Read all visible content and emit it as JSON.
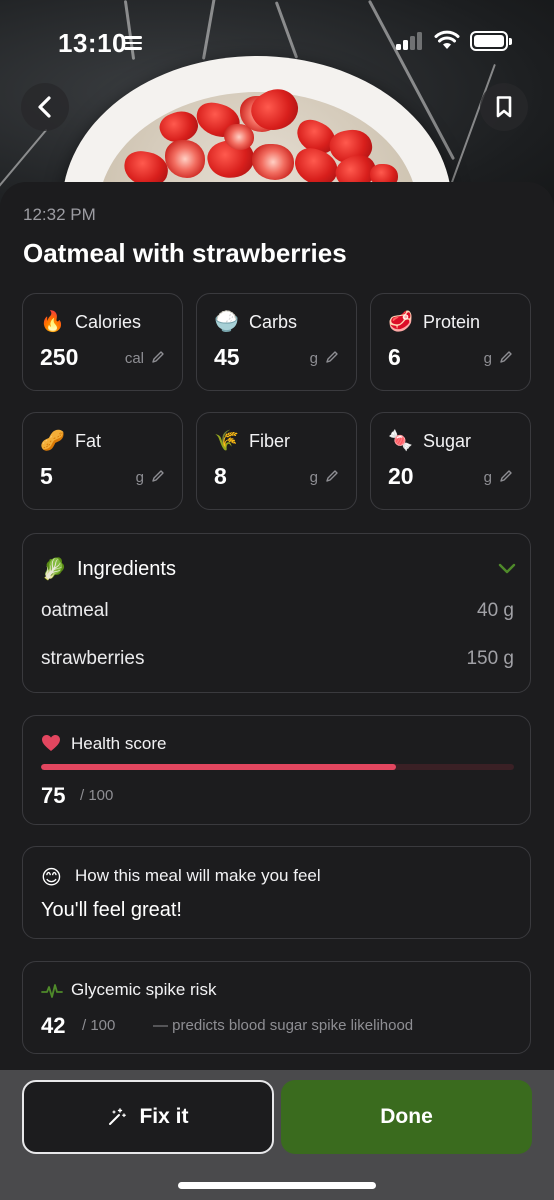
{
  "status_bar": {
    "time": "13:10"
  },
  "header": {
    "back_icon": "chevron-left-icon",
    "bookmark_icon": "bookmark-icon"
  },
  "meal": {
    "time": "12:32 PM",
    "title": "Oatmeal with strawberries"
  },
  "nutrients": [
    {
      "emoji": "🔥",
      "label": "Calories",
      "value": "250",
      "unit": "cal"
    },
    {
      "emoji": "🍚",
      "label": "Carbs",
      "value": "45",
      "unit": "g"
    },
    {
      "emoji": "🥩",
      "label": "Protein",
      "value": "6",
      "unit": "g"
    },
    {
      "emoji": "🥜",
      "label": "Fat",
      "value": "5",
      "unit": "g"
    },
    {
      "emoji": "🌾",
      "label": "Fiber",
      "value": "8",
      "unit": "g"
    },
    {
      "emoji": "🍬",
      "label": "Sugar",
      "value": "20",
      "unit": "g"
    }
  ],
  "ingredients": {
    "emoji": "🥬",
    "title": "Ingredients",
    "items": [
      {
        "name": "oatmeal",
        "amount": "40 g"
      },
      {
        "name": "strawberries",
        "amount": "150 g"
      }
    ]
  },
  "health_score": {
    "title": "Health score",
    "value": "75",
    "max": "/ 100",
    "fraction": 0.75,
    "color": "#e2465f"
  },
  "feel": {
    "emoji": "😊",
    "title": "How this meal will make you feel",
    "text": "You'll feel great!"
  },
  "glycemic": {
    "title": "Glycemic spike risk",
    "value": "42",
    "max": "/ 100",
    "description": "— predicts blood sugar spike likelihood"
  },
  "actions": {
    "fix_label": "Fix it",
    "done_label": "Done",
    "done_color": "#3a6b1e"
  }
}
